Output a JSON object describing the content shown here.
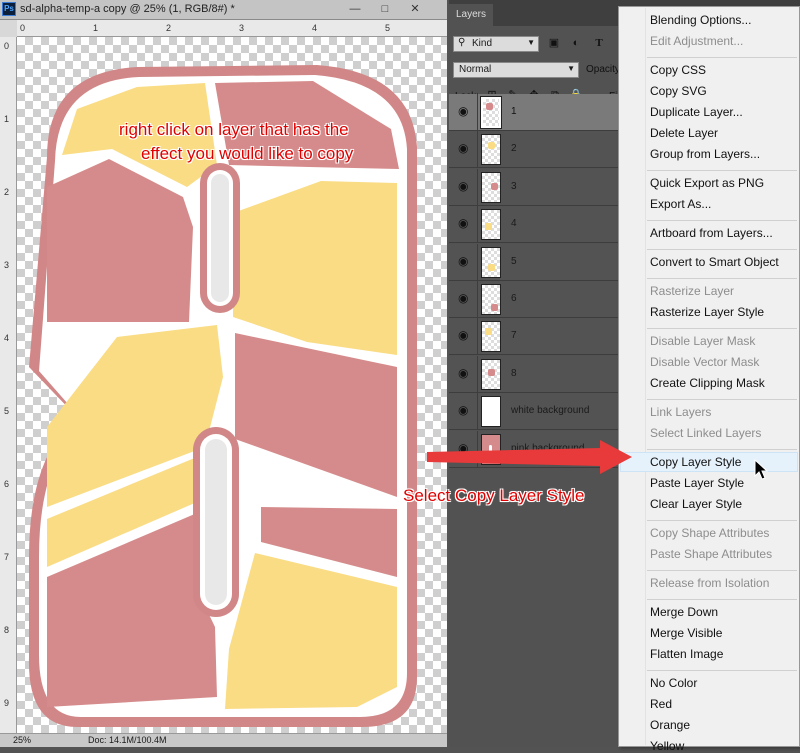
{
  "document": {
    "title": "sd-alpha-temp-a copy @ 25% (1, RGB/8#) *",
    "app_icon_text": "Ps",
    "window_controls": {
      "minimize": "—",
      "maximize": "□",
      "close": "✕"
    },
    "zoom": "25%",
    "doc_size": "Doc: 14.1M/100.4M",
    "ruler_top_labels": [
      "0",
      "1",
      "2",
      "3",
      "4",
      "5"
    ],
    "ruler_left_labels": [
      "0",
      "1",
      "2",
      "3",
      "4",
      "5",
      "6",
      "7",
      "8",
      "9"
    ]
  },
  "colors": {
    "pink": "#d58b8b",
    "yellow": "#f9dc84",
    "outline": "#d18787",
    "annotation": "#e00000",
    "menu_highlight": "#e5f1fb"
  },
  "annotations": {
    "top_line1": "right click on layer  that has the",
    "top_line2": "effect you would like to copy",
    "bottom": "Select Copy Layer Style"
  },
  "layers_panel": {
    "tab": "Layers",
    "kind_label": "Kind",
    "blend_mode": "Normal",
    "opacity_label": "Opacity",
    "lock_label": "Lock:",
    "fill_label": "Fil",
    "filter_icons": [
      "image-filter-icon",
      "adjustment-filter-icon",
      "type-filter-icon"
    ],
    "lock_icons": [
      "lock-transparent-icon",
      "lock-paint-icon",
      "lock-move-icon",
      "lock-artboard-icon",
      "lock-all-icon"
    ],
    "layers": [
      {
        "name": "1",
        "selected": true,
        "mark": "pink"
      },
      {
        "name": "2",
        "selected": false,
        "mark": "yellow"
      },
      {
        "name": "3",
        "selected": false,
        "mark": "pink"
      },
      {
        "name": "4",
        "selected": false,
        "mark": "yellow"
      },
      {
        "name": "5",
        "selected": false,
        "mark": "yellow"
      },
      {
        "name": "6",
        "selected": false,
        "mark": "pink"
      },
      {
        "name": "7",
        "selected": false,
        "mark": "yellow"
      },
      {
        "name": "8",
        "selected": false,
        "mark": "pink"
      },
      {
        "name": "white background",
        "selected": false,
        "mark": "white"
      },
      {
        "name": "pink background",
        "selected": false,
        "mark": "pinkfull"
      }
    ]
  },
  "context_menu": {
    "items": [
      {
        "label": "Blending Options...",
        "enabled": true
      },
      {
        "label": "Edit Adjustment...",
        "enabled": false
      },
      {
        "separator": true
      },
      {
        "label": "Copy CSS",
        "enabled": true
      },
      {
        "label": "Copy SVG",
        "enabled": true
      },
      {
        "label": "Duplicate Layer...",
        "enabled": true
      },
      {
        "label": "Delete Layer",
        "enabled": true
      },
      {
        "label": "Group from Layers...",
        "enabled": true
      },
      {
        "separator": true
      },
      {
        "label": "Quick Export as PNG",
        "enabled": true
      },
      {
        "label": "Export As...",
        "enabled": true
      },
      {
        "separator": true
      },
      {
        "label": "Artboard from Layers...",
        "enabled": true
      },
      {
        "separator": true
      },
      {
        "label": "Convert to Smart Object",
        "enabled": true
      },
      {
        "separator": true
      },
      {
        "label": "Rasterize Layer",
        "enabled": false
      },
      {
        "label": "Rasterize Layer Style",
        "enabled": true
      },
      {
        "separator": true
      },
      {
        "label": "Disable Layer Mask",
        "enabled": false
      },
      {
        "label": "Disable Vector Mask",
        "enabled": false
      },
      {
        "label": "Create Clipping Mask",
        "enabled": true
      },
      {
        "separator": true
      },
      {
        "label": "Link Layers",
        "enabled": false
      },
      {
        "label": "Select Linked Layers",
        "enabled": false
      },
      {
        "separator": true
      },
      {
        "label": "Copy Layer Style",
        "enabled": true,
        "highlighted": true
      },
      {
        "label": "Paste Layer Style",
        "enabled": true
      },
      {
        "label": "Clear Layer Style",
        "enabled": true
      },
      {
        "separator": true
      },
      {
        "label": "Copy Shape Attributes",
        "enabled": false
      },
      {
        "label": "Paste Shape Attributes",
        "enabled": false
      },
      {
        "separator": true
      },
      {
        "label": "Release from Isolation",
        "enabled": false
      },
      {
        "separator": true
      },
      {
        "label": "Merge Down",
        "enabled": true
      },
      {
        "label": "Merge Visible",
        "enabled": true
      },
      {
        "label": "Flatten Image",
        "enabled": true
      },
      {
        "separator": true
      },
      {
        "label": "No Color",
        "enabled": true
      },
      {
        "label": "Red",
        "enabled": true
      },
      {
        "label": "Orange",
        "enabled": true
      },
      {
        "label": "Yellow",
        "enabled": true
      }
    ]
  }
}
